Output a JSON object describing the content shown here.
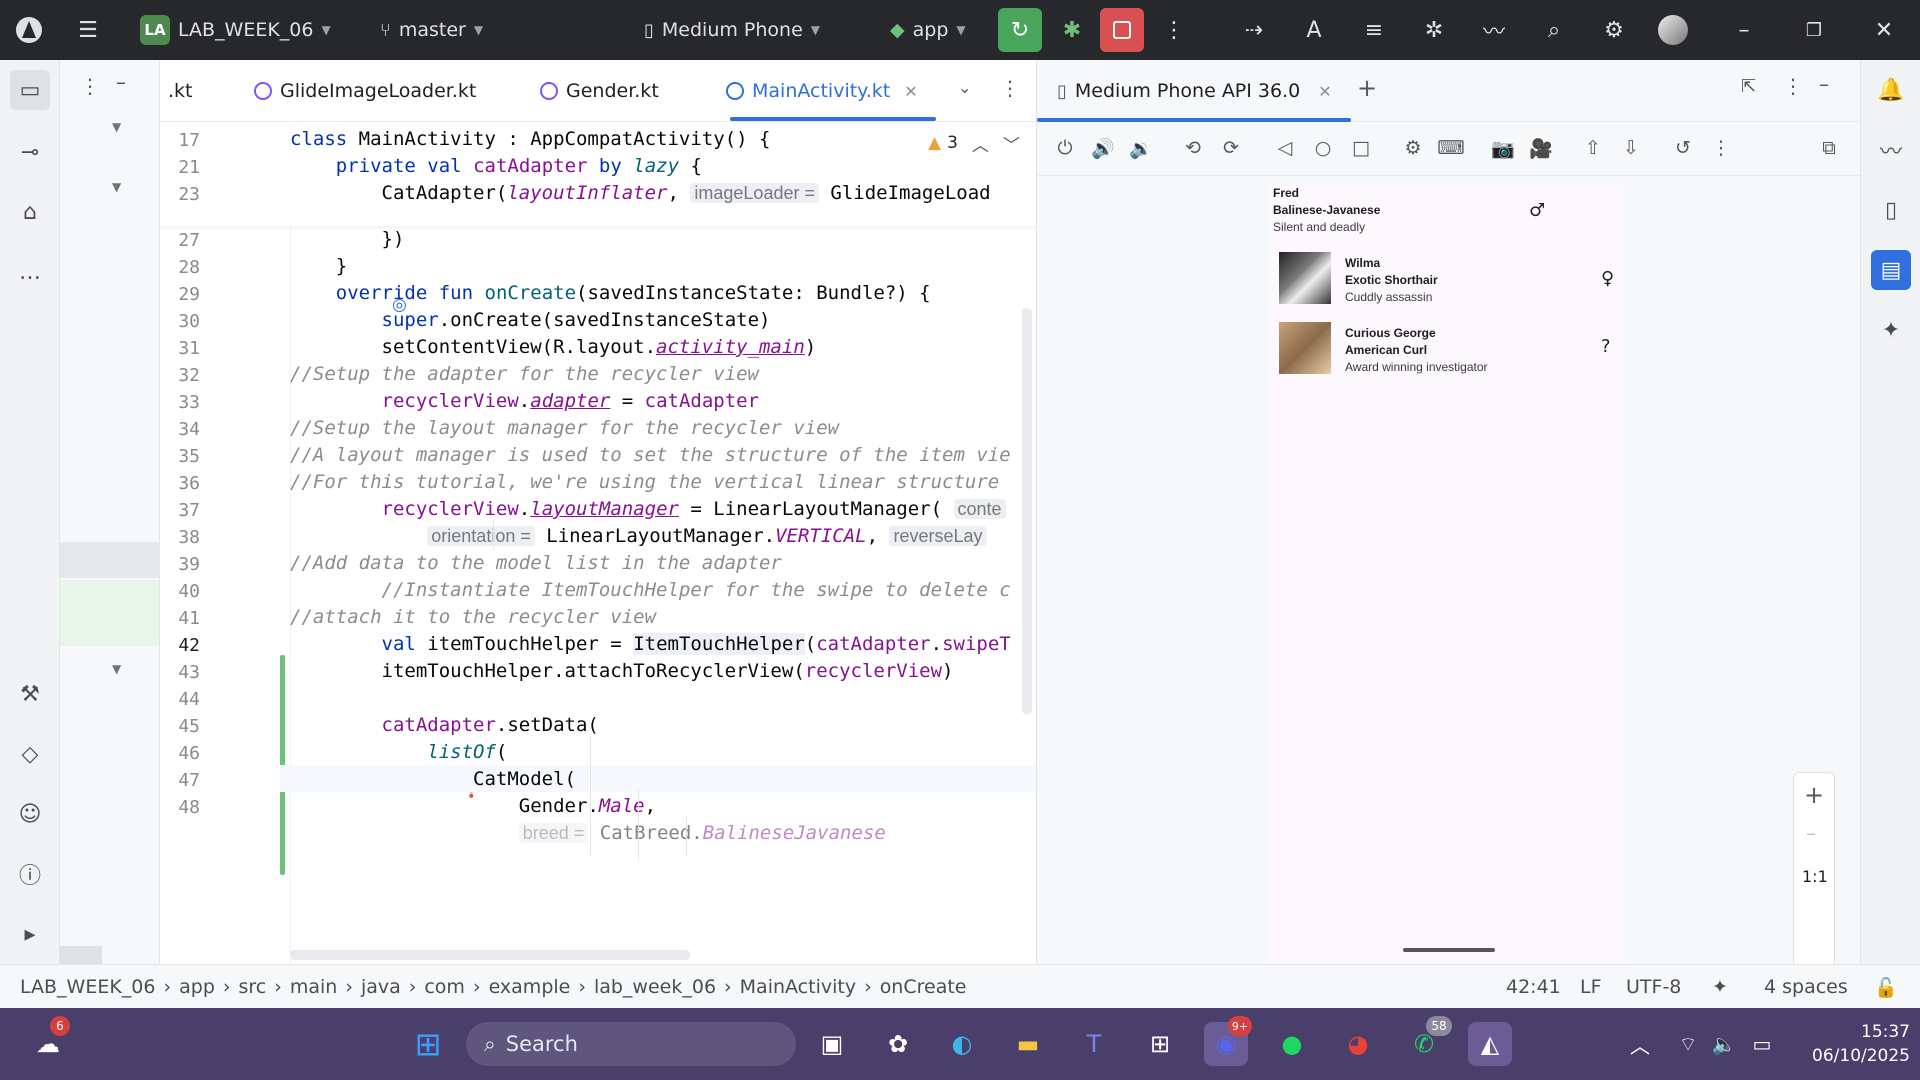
{
  "titlebar": {
    "project_badge": "LA",
    "project_name": "LAB_WEEK_06",
    "branch": "master",
    "device": "Medium Phone",
    "run_config": "app"
  },
  "editor": {
    "tabs": [
      {
        "label": ".kt"
      },
      {
        "label": "GlideImageLoader.kt"
      },
      {
        "label": "Gender.kt"
      },
      {
        "label": "MainActivity.kt"
      }
    ],
    "warnings_count": "3",
    "line_numbers": [
      "17",
      "21",
      "23",
      "27",
      "28",
      "29",
      "30",
      "31",
      "32",
      "33",
      "34",
      "35",
      "36",
      "37",
      "38",
      "39",
      "40",
      "41",
      "42",
      "43",
      "44",
      "45",
      "46",
      "47",
      "48"
    ],
    "hints": {
      "imageLoader": "imageLoader =",
      "conte": "conte",
      "orientation": "orientation =",
      "reverse": "reverseLay",
      "breed": "breed ="
    }
  },
  "emulator": {
    "tab_label": "Medium Phone API 36.0",
    "zoom_label": "1:1",
    "cats": [
      {
        "name": "Fred",
        "breed": "Balinese-Javanese",
        "description": "Silent and deadly",
        "gender": "♂"
      },
      {
        "name": "Wilma",
        "breed": "Exotic Shorthair",
        "description": "Cuddly assassin",
        "gender": "♀"
      },
      {
        "name": "Curious George",
        "breed": "American Curl",
        "description": "Award winning investigator",
        "gender": "?"
      }
    ]
  },
  "statusbar": {
    "breadcrumbs": [
      "LAB_WEEK_06",
      "app",
      "src",
      "main",
      "java",
      "com",
      "example",
      "lab_week_06",
      "MainActivity",
      "onCreate"
    ],
    "position": "42:41",
    "line_ending": "LF",
    "encoding": "UTF-8",
    "indent": "4 spaces"
  },
  "taskbar": {
    "search_placeholder": "Search",
    "weather_badge": "6",
    "discord_badge": "9+",
    "whatsapp_badge": "58",
    "time": "15:37",
    "date": "06/10/2025"
  },
  "colors": {
    "accent": "#2f6fde",
    "titlebar_bg": "#27282c",
    "taskbar_bg": "#4a3f6b",
    "run_green": "#4aa55c",
    "stop_red": "#d95050"
  }
}
